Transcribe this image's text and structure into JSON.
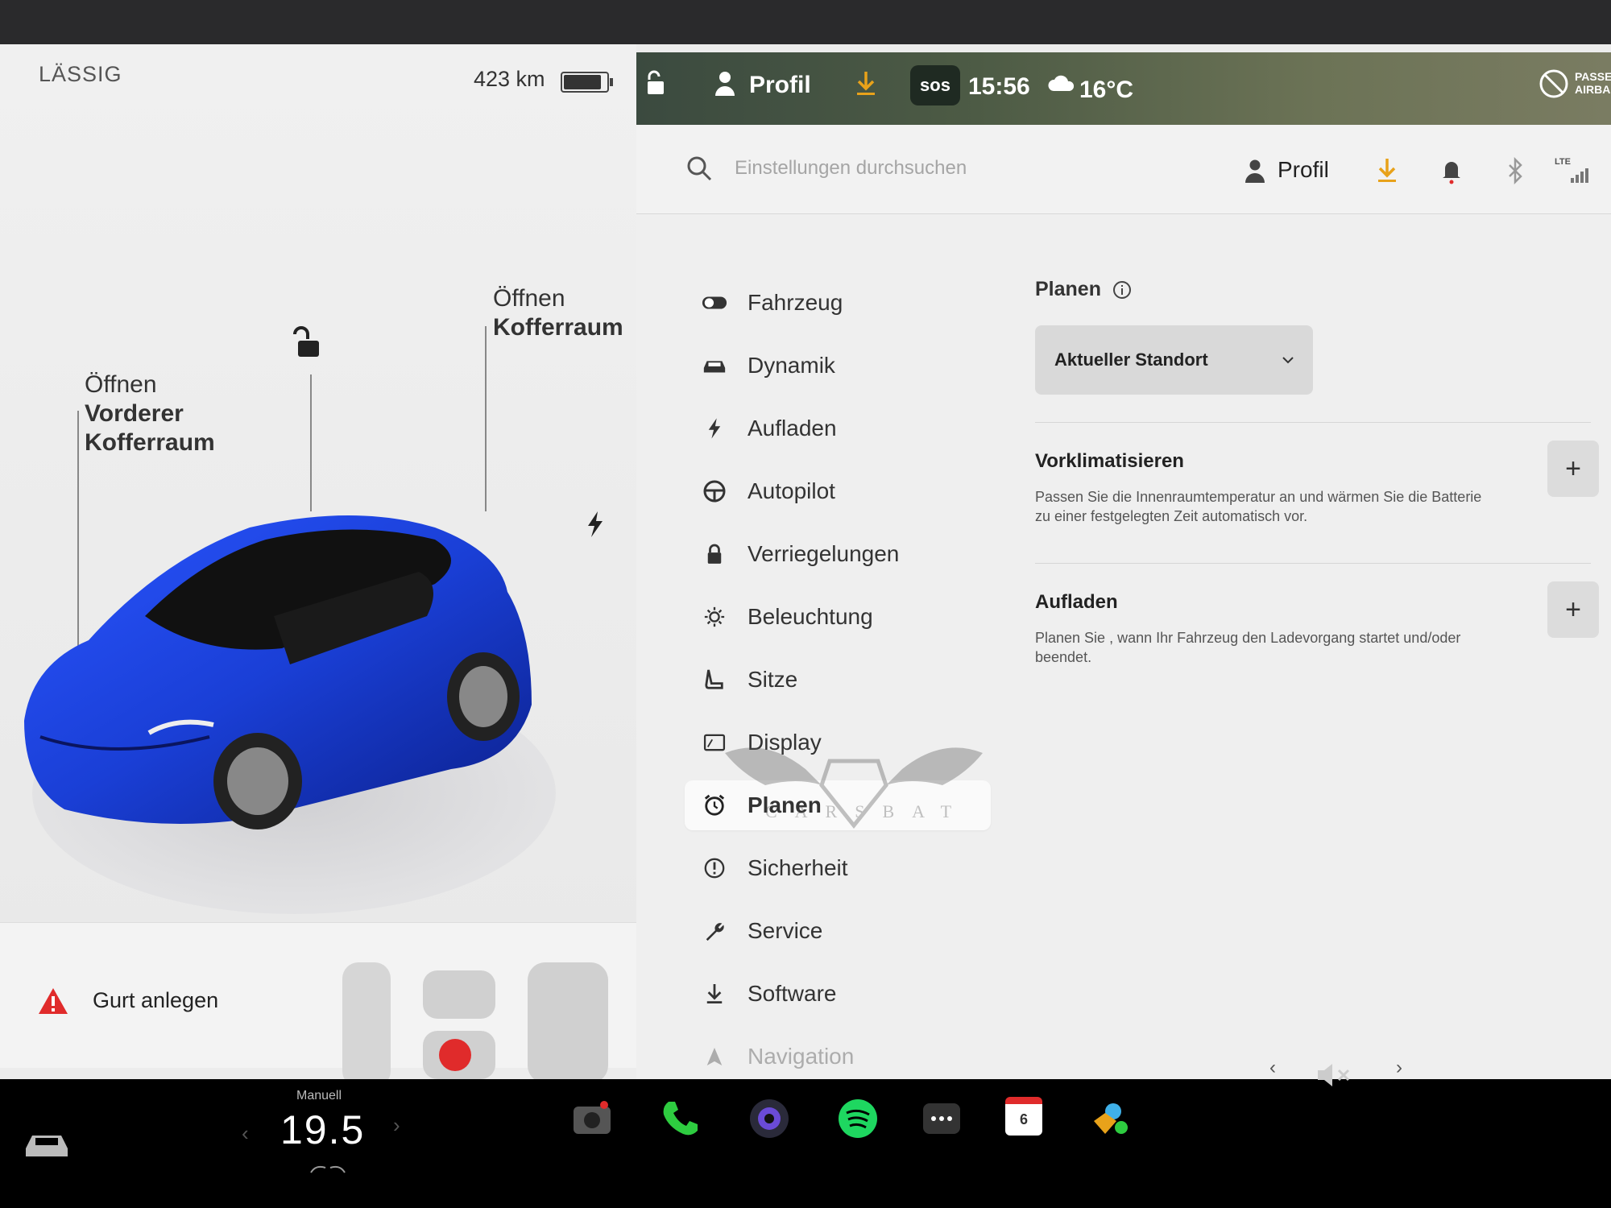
{
  "vehicle": {
    "drive_mode": "LÄSSIG",
    "range": "423 km",
    "battery_level": 0.9,
    "frunk_label_top": "Öffnen",
    "frunk_label_bottom": "Vorderer Kofferraum",
    "frunk_label_1": "Vorderer",
    "frunk_label_2": "Kofferraum",
    "trunk_label_top": "Öffnen",
    "trunk_label_bottom": "Kofferraum",
    "car_color": "#1a3fd6"
  },
  "seatbelt": {
    "warning": "Gurt anlegen"
  },
  "statusbar": {
    "profile": "Profil",
    "sos": "sos",
    "time": "15:56",
    "temperature": "16°C",
    "airbag_line1": "PASSEN",
    "airbag_line2": "AIRBAG"
  },
  "header": {
    "search_placeholder": "Einstellungen durchsuchen",
    "profile": "Profil",
    "lte": "LTE",
    "accent_color": "#e8a21a"
  },
  "nav": {
    "items": [
      {
        "label": "Fahrzeug",
        "icon": "toggle-icon"
      },
      {
        "label": "Dynamik",
        "icon": "car-icon"
      },
      {
        "label": "Aufladen",
        "icon": "bolt-icon"
      },
      {
        "label": "Autopilot",
        "icon": "steering-wheel-icon"
      },
      {
        "label": "Verriegelungen",
        "icon": "lock-icon"
      },
      {
        "label": "Beleuchtung",
        "icon": "light-icon"
      },
      {
        "label": "Sitze",
        "icon": "seat-icon"
      },
      {
        "label": "Display",
        "icon": "display-icon"
      },
      {
        "label": "Planen",
        "icon": "alarm-clock-icon",
        "active": true
      },
      {
        "label": "Sicherheit",
        "icon": "alert-circle-icon"
      },
      {
        "label": "Service",
        "icon": "wrench-icon"
      },
      {
        "label": "Software",
        "icon": "download-icon"
      },
      {
        "label": "Navigation",
        "icon": "navigation-icon"
      }
    ],
    "watermark": "CARSBAT"
  },
  "content": {
    "title": "Planen",
    "location": "Aktueller Standort",
    "preclimate": {
      "title": "Vorklimatisieren",
      "description": "Passen Sie die Innenraumtemperatur an und wärmen Sie die Batterie zu einer festgelegten Zeit automatisch vor.",
      "add": "+"
    },
    "charging": {
      "title": "Aufladen",
      "description": "Planen Sie , wann Ihr Fahrzeug den Ladevorgang startet und/oder beendet.",
      "add": "+"
    }
  },
  "dock": {
    "climate_mode": "Manuell",
    "temperature": "19.5",
    "calendar_day": "6",
    "left_arrow": "‹",
    "right_arrow": "›"
  }
}
